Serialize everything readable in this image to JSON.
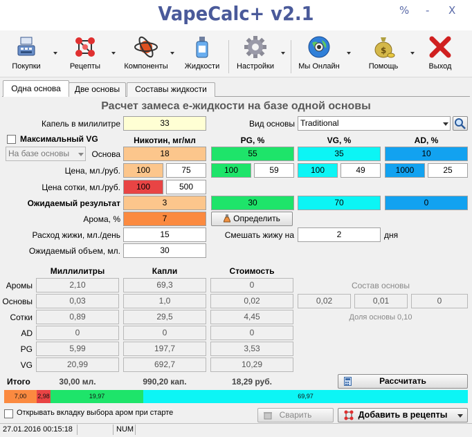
{
  "window": {
    "title": "VapeCalc+ v2.1",
    "btn_restore": "%",
    "btn_minimize": "-",
    "btn_close": "X"
  },
  "toolbar": {
    "purchases": "Покупки",
    "recipes": "Рецепты",
    "components": "Компоненты",
    "liquids": "Жидкости",
    "settings": "Настройки",
    "online": "Мы Онлайн",
    "help": "Помощь",
    "exit": "Выход"
  },
  "tabs": {
    "one_base": "Одна основа",
    "two_bases": "Две основы",
    "liquid_compositions": "Составы жидкости"
  },
  "form": {
    "section_title": "Расчет замеса е-жидкости на базе одной основы",
    "drops_per_ml_label": "Капель в милилитре",
    "drops_per_ml": "33",
    "base_type_label": "Вид основы",
    "base_type": "Traditional",
    "max_vg_label": "Максимальный VG",
    "base_mode": "На базе основы",
    "col_nicotine": "Никотин, мг/мл",
    "col_pg": "PG, %",
    "col_vg": "VG, %",
    "col_ad": "AD, %",
    "base_label": "Основа",
    "base_nicotine": "18",
    "base_pg": "55",
    "base_vg": "35",
    "base_ad": "10",
    "price_label": "Цена, мл./руб.",
    "price_nic_ml": "100",
    "price_nic_rub": "75",
    "price_pg_ml": "100",
    "price_pg_rub": "59",
    "price_vg_ml": "100",
    "price_vg_rub": "49",
    "price_ad_ml": "1000",
    "price_ad_rub": "25",
    "hundred_price_label": "Цена сотки, мл./руб.",
    "hundred_ml": "100",
    "hundred_rub": "500",
    "expected_label": "Ожидаемый результат",
    "expected_nicotine": "3",
    "expected_pg": "30",
    "expected_vg": "70",
    "expected_ad": "0",
    "aroma_label": "Арома, %",
    "aroma_value": "7",
    "determine_button": "Определить",
    "consumption_label": "Расход жижи, мл./день",
    "consumption_value": "15",
    "mix_label": "Смешать жижу на",
    "mix_days": "2",
    "days_label": "дня",
    "volume_label": "Ожидаемый объем, мл.",
    "volume_value": "30"
  },
  "results": {
    "col_ml": "Миллилитры",
    "col_drops": "Капли",
    "col_cost": "Стоимость",
    "rows": [
      {
        "label": "Аромы",
        "ml": "2,10",
        "drops": "69,3",
        "cost": "0"
      },
      {
        "label": "Основы",
        "ml": "0,03",
        "drops": "1,0",
        "cost": "0,02"
      },
      {
        "label": "Сотки",
        "ml": "0,89",
        "drops": "29,5",
        "cost": "4,45"
      },
      {
        "label": "AD",
        "ml": "0",
        "drops": "0",
        "cost": "0"
      },
      {
        "label": "PG",
        "ml": "5,99",
        "drops": "197,7",
        "cost": "3,53"
      },
      {
        "label": "VG",
        "ml": "20,99",
        "drops": "692,7",
        "cost": "10,29"
      }
    ],
    "base_comp_label": "Состав основы",
    "base_comp_values": [
      "0,02",
      "0,01",
      "0"
    ],
    "base_share": "Доля основы 0,10",
    "total_label": "Итого",
    "total_ml": "30,00 мл.",
    "total_drops": "990,20 кап.",
    "total_cost": "18,29 руб.",
    "calculate_button": "Рассчитать"
  },
  "mix_bar": {
    "segments": [
      {
        "label": "7,00",
        "value": 7.0,
        "color": "#fb8a40"
      },
      {
        "label": "2,98",
        "value": 2.98,
        "color": "#e84444"
      },
      {
        "label": "19,97",
        "value": 19.97,
        "color": "#1ee46a"
      },
      {
        "label": "69,97",
        "value": 69.97,
        "color": "#0cf5f5"
      }
    ]
  },
  "bottom": {
    "open_aromas_checkbox": "Открывать вкладку выбора аром при старте",
    "brew_button": "Сварить",
    "add_to_recipes_button": "Добавить в рецепты"
  },
  "status": {
    "datetime": "27.01.2016 00:15:18",
    "num": "NUM"
  },
  "colors": {
    "nicotine": "#fcc68c",
    "pg": "#1ee46a",
    "vg": "#0cf5f5",
    "ad": "#12a2f0",
    "aroma": "#fb8a40",
    "hundred": "#e84444",
    "title": "#4a5a9a"
  }
}
